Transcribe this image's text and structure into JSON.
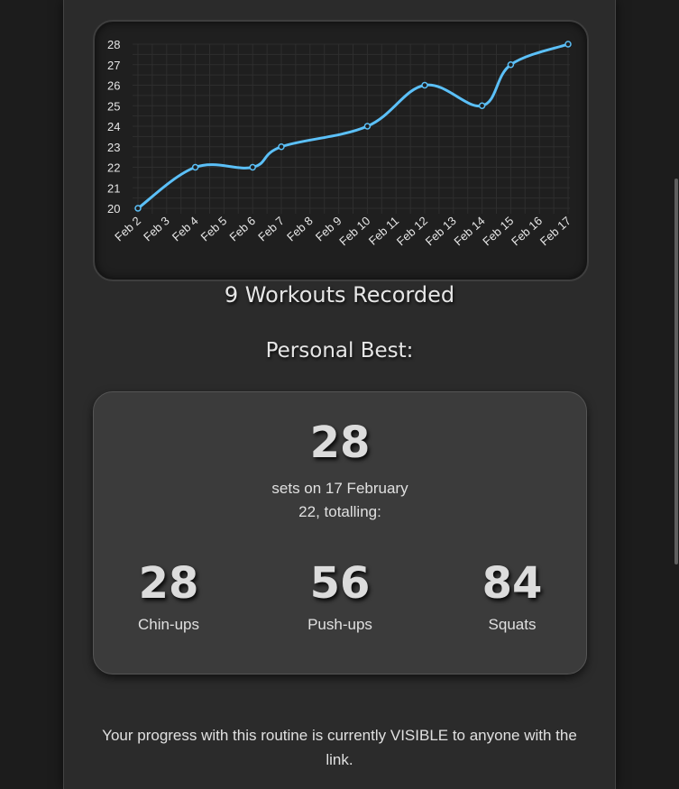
{
  "chart_data": {
    "type": "line",
    "categories": [
      "Feb 2",
      "Feb 3",
      "Feb 4",
      "Feb 5",
      "Feb 6",
      "Feb 7",
      "Feb 8",
      "Feb 9",
      "Feb 10",
      "Feb 11",
      "Feb 12",
      "Feb 13",
      "Feb 14",
      "Feb 15",
      "Feb 16",
      "Feb 17"
    ],
    "points": [
      {
        "x": "Feb 2",
        "y": 20
      },
      {
        "x": "Feb 4",
        "y": 22
      },
      {
        "x": "Feb 6",
        "y": 22
      },
      {
        "x": "Feb 7",
        "y": 23
      },
      {
        "x": "Feb 10",
        "y": 24
      },
      {
        "x": "Feb 12",
        "y": 26
      },
      {
        "x": "Feb 14",
        "y": 25
      },
      {
        "x": "Feb 15",
        "y": 27
      },
      {
        "x": "Feb 17",
        "y": 28
      }
    ],
    "yticks": [
      20,
      21,
      22,
      23,
      24,
      25,
      26,
      27,
      28
    ],
    "ylim": [
      20,
      28
    ],
    "line_color": "#5bc0f8",
    "grid": true
  },
  "summary": {
    "workouts_recorded": "9 Workouts Recorded",
    "personal_best_heading": "Personal Best:"
  },
  "personal_best": {
    "total_sets": "28",
    "description_line1": "sets on 17 February",
    "description_line2": "22, totalling:",
    "exercises": [
      {
        "count": "28",
        "name": "Chin-ups"
      },
      {
        "count": "56",
        "name": "Push-ups"
      },
      {
        "count": "84",
        "name": "Squats"
      }
    ]
  },
  "visibility_note": "Your progress with this routine is currently VISIBLE to anyone with the link."
}
